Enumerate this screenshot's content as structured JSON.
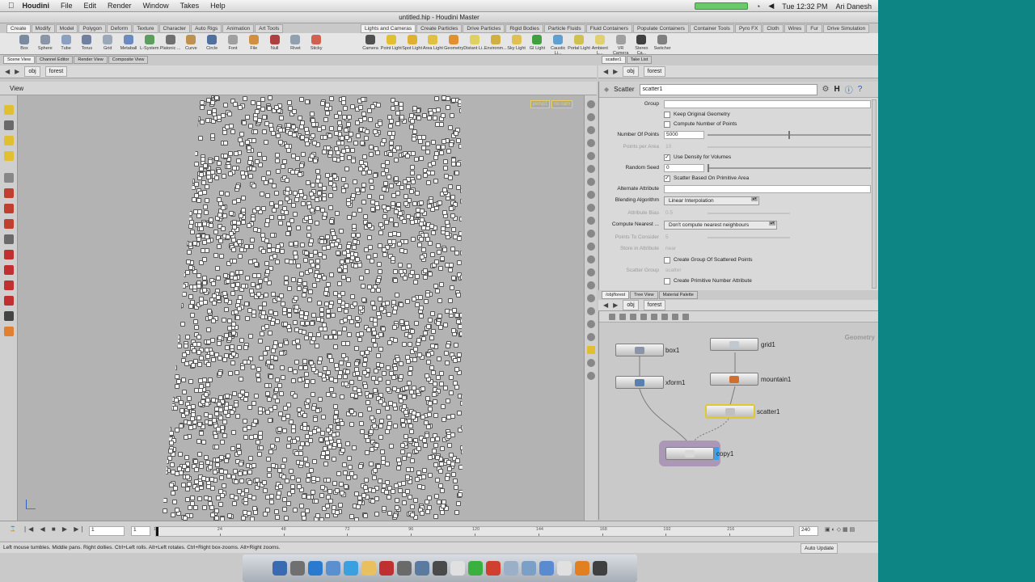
{
  "mac_menubar": {
    "apple": "",
    "app_name": "Houdini",
    "menus": [
      "File",
      "Edit",
      "Render",
      "Window",
      "Takes",
      "Help"
    ],
    "clock": "Tue 12:32 PM",
    "user": "Ari Danesh"
  },
  "window": {
    "title": "untitled.hip - Houdini Master"
  },
  "shelf_tabs_left": [
    {
      "label": "Create",
      "active": true
    },
    {
      "label": "Modify"
    },
    {
      "label": "Model"
    },
    {
      "label": "Polygon"
    },
    {
      "label": "Deform"
    },
    {
      "label": "Texture"
    },
    {
      "label": "Character"
    },
    {
      "label": "Auto Rigs"
    },
    {
      "label": "Animation"
    },
    {
      "label": "Art Tools"
    }
  ],
  "shelf_tabs_right": [
    {
      "label": "Lights and Cameras",
      "active": true
    },
    {
      "label": "Create Particles"
    },
    {
      "label": "Drive Particles"
    },
    {
      "label": "Rigid Bodies"
    },
    {
      "label": "Particle Fluids"
    },
    {
      "label": "Fluid Containers"
    },
    {
      "label": "Populate Containers"
    },
    {
      "label": "Container Tools"
    },
    {
      "label": "Pyro FX"
    },
    {
      "label": "Cloth"
    },
    {
      "label": "Wires"
    },
    {
      "label": "Fur"
    },
    {
      "label": "Drive Simulation"
    }
  ],
  "shelf_tools_left": [
    {
      "label": "Box",
      "color": "#7a8aa0"
    },
    {
      "label": "Sphere",
      "color": "#8a96a8"
    },
    {
      "label": "Tube",
      "color": "#8aa0c0"
    },
    {
      "label": "Torus",
      "color": "#7080a0"
    },
    {
      "label": "Grid",
      "color": "#9aa8b8"
    },
    {
      "label": "Metaball",
      "color": "#6a8ac0"
    },
    {
      "label": "L-System",
      "color": "#5aa05a"
    },
    {
      "label": "Platonic ...",
      "color": "#707070"
    },
    {
      "label": "Curve",
      "color": "#c09050"
    },
    {
      "label": "Circle",
      "color": "#5070a0"
    },
    {
      "label": "Font",
      "color": "#a0a0a0"
    },
    {
      "label": "File",
      "color": "#d09040"
    },
    {
      "label": "Null",
      "color": "#b04040"
    },
    {
      "label": "Rivet",
      "color": "#90a0b0"
    },
    {
      "label": "Sticky",
      "color": "#d06050"
    }
  ],
  "shelf_tools_right": [
    {
      "label": "Camera",
      "color": "#505050"
    },
    {
      "label": "Point Light",
      "color": "#e0c030"
    },
    {
      "label": "Spot Light",
      "color": "#e0b030"
    },
    {
      "label": "Area Light",
      "color": "#e0c040"
    },
    {
      "label": "Geometry",
      "color": "#e09030"
    },
    {
      "label": "Distant Li...",
      "color": "#e0d060"
    },
    {
      "label": "Environm...",
      "color": "#d0b040"
    },
    {
      "label": "Sky Light",
      "color": "#e0c050"
    },
    {
      "label": "GI Light",
      "color": "#40a040"
    },
    {
      "label": "Caustic Li...",
      "color": "#60a0d0"
    },
    {
      "label": "Portal Light",
      "color": "#d0c050"
    },
    {
      "label": "Ambient L...",
      "color": "#e0d070"
    },
    {
      "label": "VR Camera",
      "color": "#a0a0a0"
    },
    {
      "label": "Stereo Ca...",
      "color": "#404040"
    },
    {
      "label": "Switcher",
      "color": "#808080"
    }
  ],
  "left_pane_tabs": [
    {
      "label": "Scene View",
      "active": true
    },
    {
      "label": "Channel Editor"
    },
    {
      "label": "Render View"
    },
    {
      "label": "Composite View"
    }
  ],
  "right_pane_tabs": [
    {
      "label": "scatter1",
      "active": true
    },
    {
      "label": "Take List"
    }
  ],
  "network_tabs": [
    {
      "label": "/obj/forest",
      "active": true
    },
    {
      "label": "Tree View"
    },
    {
      "label": "Material Palette"
    }
  ],
  "viewer": {
    "path_obj": "obj",
    "path_node": "forest",
    "header": "View",
    "persp": "persp1",
    "cam": "no cam"
  },
  "params": {
    "path_obj": "obj",
    "path_node": "forest",
    "node_type": "Scatter",
    "node_name": "scatter1",
    "group_label": "Group",
    "group_value": "",
    "keep_original": {
      "label": "Keep Original Geometry",
      "checked": false
    },
    "compute_number": {
      "label": "Compute Number of Points",
      "checked": false
    },
    "number_of_points": {
      "label": "Number Of Points",
      "value": "5000",
      "slider_fraction": 0.5
    },
    "points_per_area": {
      "label": "Points per Area",
      "value": "10"
    },
    "use_density": {
      "label": "Use Density for Volumes",
      "checked": true
    },
    "random_seed": {
      "label": "Random Seed",
      "value": "0",
      "slider_fraction": 0
    },
    "scatter_based": {
      "label": "Scatter Based On Primitive Area",
      "checked": true
    },
    "alternate_attribute": {
      "label": "Alternate Attribute",
      "value": ""
    },
    "blending": {
      "label": "Blending Algorithm",
      "value": "Linear Interpolation"
    },
    "attribute_bias": {
      "label": "Attribute Bias",
      "value": "0.5"
    },
    "compute_nearest": {
      "label": "Compute Nearest ...",
      "value": "Don't compute nearest neighbours"
    },
    "points_to_consider": {
      "label": "Points To Consider",
      "value": "5"
    },
    "store_attribute": {
      "label": "Store in Attribute",
      "value": "near"
    },
    "create_group": {
      "label": "Create Group Of Scattered Points",
      "checked": false
    },
    "scatter_group": {
      "label": "Scatter Group",
      "value": "scatter"
    },
    "create_prim_number": {
      "label": "Create Primitive Number Attribute",
      "checked": false
    }
  },
  "network": {
    "path_obj": "obj",
    "path_node": "forest",
    "context_label": "Geometry",
    "nodes": {
      "box1": {
        "label": "box1",
        "icon_color": "#8a96a8"
      },
      "grid1": {
        "label": "grid1",
        "icon_color": "#c0c8d0"
      },
      "xform1": {
        "label": "xform1",
        "icon_color": "#5a80b0"
      },
      "mountain1": {
        "label": "mountain1",
        "icon_color": "#d07030"
      },
      "scatter1": {
        "label": "scatter1",
        "icon_color": "#c0c0c0"
      },
      "copy1": {
        "label": "copy1",
        "icon_color": "#d8d8d8"
      }
    }
  },
  "timeline": {
    "frame_field": "1",
    "start_field": "1",
    "ticks": [
      "1",
      "24",
      "48",
      "72",
      "96",
      "120",
      "144",
      "168",
      "192",
      "216"
    ],
    "end_field": "240"
  },
  "status": {
    "text": "Left mouse tumbles. Middle pans. Right dollies. Ctrl+Left rolls. Alt+Left rotates. Ctrl+Right box-zooms. Alt+Right zooms.",
    "auto_update": "Auto Update"
  },
  "dock_colors": [
    "#3a6ab0",
    "#707070",
    "#2a7ad0",
    "#5a90d0",
    "#3aa0e0",
    "#e8c060",
    "#c03030",
    "#6a6a6a",
    "#5a7aa0",
    "#4a4a4a",
    "#e0e0e0",
    "#3ab040",
    "#d04030",
    "#9ab0c8",
    "#7aa0c8",
    "#5a8ad0",
    "#e0e0e0",
    "#e08020",
    "#404040"
  ]
}
